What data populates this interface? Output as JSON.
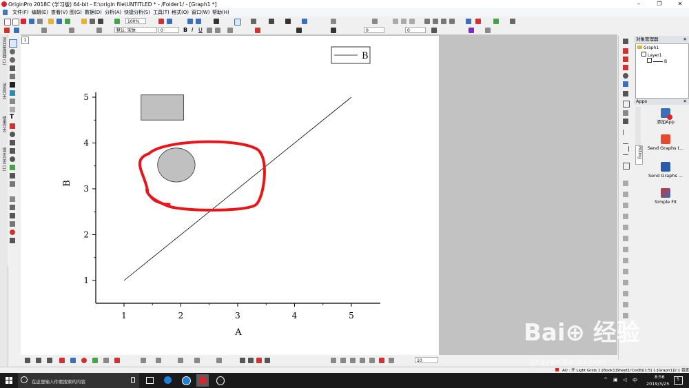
{
  "app": {
    "title": "OriginPro 2018C (学习版) 64-bit - E:\\origin file\\UNTITLED * - /Folder1/ - [Graph1 *]",
    "window_controls": [
      "–",
      "❐",
      "✕"
    ]
  },
  "menu": [
    "文件(F)",
    "编辑(E)",
    "查看(V)",
    "图(G)",
    "数据(D)",
    "分析(A)",
    "快捷分析(S)",
    "工具(T)",
    "格式(O)",
    "窗口(W)",
    "帮助(H)"
  ],
  "toolbar": {
    "zoom": "100%",
    "font": "默认: 宋体",
    "font_size": "0",
    "line_size": "0",
    "fill_value": "0",
    "bottom_size": "10"
  },
  "left_tabs": [
    "项目管理器 (1)",
    "消息日志",
    "结果日志",
    "提示日志 (1)"
  ],
  "graph": {
    "layer_label": "1",
    "legend": "B",
    "xlabel": "A",
    "ylabel": "B",
    "xticks": [
      "1",
      "2",
      "3",
      "4",
      "5"
    ],
    "yticks": [
      "1",
      "2",
      "3",
      "4",
      "5"
    ]
  },
  "chart_data": {
    "type": "line",
    "series": [
      {
        "name": "B",
        "x": [
          1,
          5
        ],
        "y": [
          1,
          5
        ]
      }
    ],
    "xlabel": "A",
    "ylabel": "B",
    "xlim": [
      0.5,
      5.5
    ],
    "ylim": [
      0.5,
      5.5
    ],
    "grid": false,
    "legend": "top-right",
    "annotations": [
      {
        "shape": "rectangle",
        "x": [
          1.3,
          2.05
        ],
        "y": [
          4.5,
          5.05
        ],
        "fill": "#c0c0c0"
      },
      {
        "shape": "ellipse",
        "cx": 1.92,
        "cy": 3.52,
        "rx": 0.33,
        "ry": 0.37,
        "fill": "#c0c0c0"
      }
    ]
  },
  "highlight_color": "#e8161b",
  "object_manager": {
    "title": "对象管理器",
    "tree": [
      "Graph1",
      "Layer1",
      "B"
    ]
  },
  "apps_panel": {
    "title": "Apps",
    "side_tab": "Fitting",
    "items": [
      {
        "label": "添加App",
        "icon": "add-app-icon"
      },
      {
        "label": "Send Graphs t...",
        "icon": "send-graphs-pdf-icon"
      },
      {
        "label": "Send Graphs ...",
        "icon": "send-graphs-word-icon"
      },
      {
        "label": "Simple Fit",
        "icon": "simple-fit-icon"
      }
    ]
  },
  "statusbar": {
    "text": "AU : 开  Light Grids  1:[Book1]Sheet1!Col(B)[1:5]  1:[Graph1]1!1  弧度"
  },
  "taskbar": {
    "search_placeholder": "在这里输入你要搜索的内容",
    "time": "8:56",
    "date": "2019/3/25",
    "notifications": "5"
  },
  "watermark": {
    "text": "Bai⊕ 经验",
    "url": "jingyan.baidu.com"
  }
}
